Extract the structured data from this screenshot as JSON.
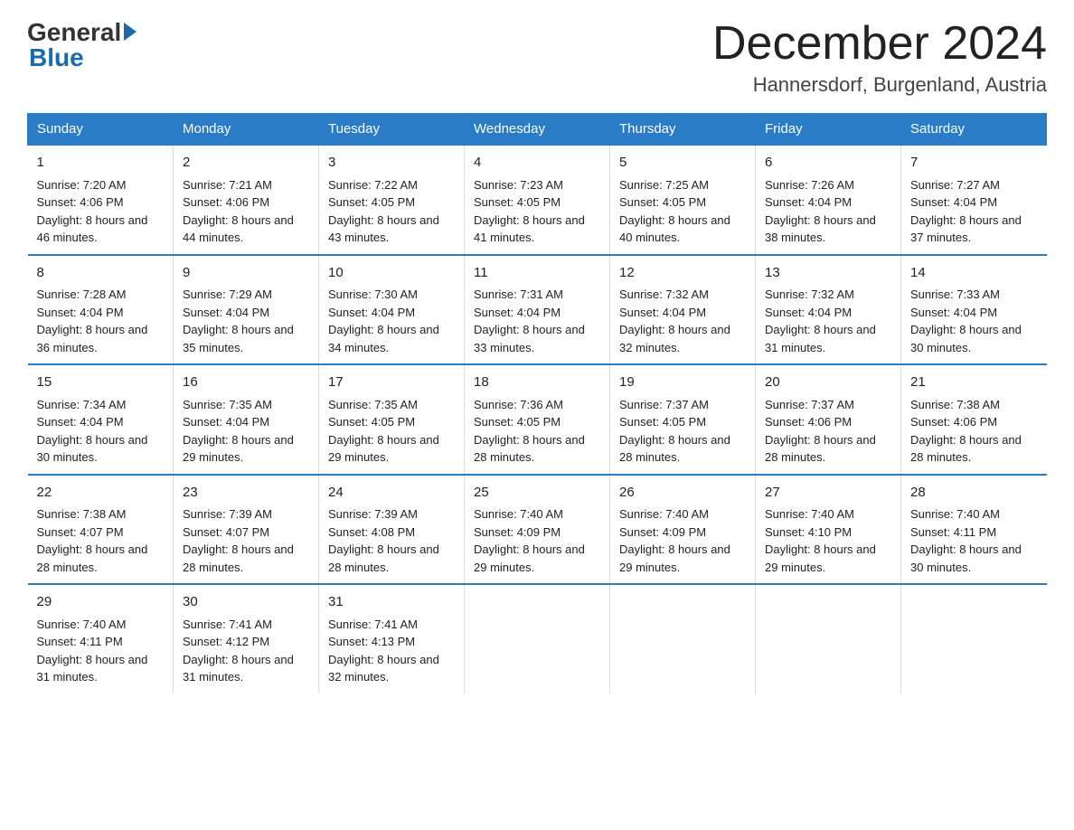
{
  "header": {
    "logo_general": "General",
    "logo_blue": "Blue",
    "month_title": "December 2024",
    "location": "Hannersdorf, Burgenland, Austria"
  },
  "days_of_week": [
    "Sunday",
    "Monday",
    "Tuesday",
    "Wednesday",
    "Thursday",
    "Friday",
    "Saturday"
  ],
  "weeks": [
    [
      {
        "day": "1",
        "sunrise": "7:20 AM",
        "sunset": "4:06 PM",
        "daylight": "8 hours and 46 minutes."
      },
      {
        "day": "2",
        "sunrise": "7:21 AM",
        "sunset": "4:06 PM",
        "daylight": "8 hours and 44 minutes."
      },
      {
        "day": "3",
        "sunrise": "7:22 AM",
        "sunset": "4:05 PM",
        "daylight": "8 hours and 43 minutes."
      },
      {
        "day": "4",
        "sunrise": "7:23 AM",
        "sunset": "4:05 PM",
        "daylight": "8 hours and 41 minutes."
      },
      {
        "day": "5",
        "sunrise": "7:25 AM",
        "sunset": "4:05 PM",
        "daylight": "8 hours and 40 minutes."
      },
      {
        "day": "6",
        "sunrise": "7:26 AM",
        "sunset": "4:04 PM",
        "daylight": "8 hours and 38 minutes."
      },
      {
        "day": "7",
        "sunrise": "7:27 AM",
        "sunset": "4:04 PM",
        "daylight": "8 hours and 37 minutes."
      }
    ],
    [
      {
        "day": "8",
        "sunrise": "7:28 AM",
        "sunset": "4:04 PM",
        "daylight": "8 hours and 36 minutes."
      },
      {
        "day": "9",
        "sunrise": "7:29 AM",
        "sunset": "4:04 PM",
        "daylight": "8 hours and 35 minutes."
      },
      {
        "day": "10",
        "sunrise": "7:30 AM",
        "sunset": "4:04 PM",
        "daylight": "8 hours and 34 minutes."
      },
      {
        "day": "11",
        "sunrise": "7:31 AM",
        "sunset": "4:04 PM",
        "daylight": "8 hours and 33 minutes."
      },
      {
        "day": "12",
        "sunrise": "7:32 AM",
        "sunset": "4:04 PM",
        "daylight": "8 hours and 32 minutes."
      },
      {
        "day": "13",
        "sunrise": "7:32 AM",
        "sunset": "4:04 PM",
        "daylight": "8 hours and 31 minutes."
      },
      {
        "day": "14",
        "sunrise": "7:33 AM",
        "sunset": "4:04 PM",
        "daylight": "8 hours and 30 minutes."
      }
    ],
    [
      {
        "day": "15",
        "sunrise": "7:34 AM",
        "sunset": "4:04 PM",
        "daylight": "8 hours and 30 minutes."
      },
      {
        "day": "16",
        "sunrise": "7:35 AM",
        "sunset": "4:04 PM",
        "daylight": "8 hours and 29 minutes."
      },
      {
        "day": "17",
        "sunrise": "7:35 AM",
        "sunset": "4:05 PM",
        "daylight": "8 hours and 29 minutes."
      },
      {
        "day": "18",
        "sunrise": "7:36 AM",
        "sunset": "4:05 PM",
        "daylight": "8 hours and 28 minutes."
      },
      {
        "day": "19",
        "sunrise": "7:37 AM",
        "sunset": "4:05 PM",
        "daylight": "8 hours and 28 minutes."
      },
      {
        "day": "20",
        "sunrise": "7:37 AM",
        "sunset": "4:06 PM",
        "daylight": "8 hours and 28 minutes."
      },
      {
        "day": "21",
        "sunrise": "7:38 AM",
        "sunset": "4:06 PM",
        "daylight": "8 hours and 28 minutes."
      }
    ],
    [
      {
        "day": "22",
        "sunrise": "7:38 AM",
        "sunset": "4:07 PM",
        "daylight": "8 hours and 28 minutes."
      },
      {
        "day": "23",
        "sunrise": "7:39 AM",
        "sunset": "4:07 PM",
        "daylight": "8 hours and 28 minutes."
      },
      {
        "day": "24",
        "sunrise": "7:39 AM",
        "sunset": "4:08 PM",
        "daylight": "8 hours and 28 minutes."
      },
      {
        "day": "25",
        "sunrise": "7:40 AM",
        "sunset": "4:09 PM",
        "daylight": "8 hours and 29 minutes."
      },
      {
        "day": "26",
        "sunrise": "7:40 AM",
        "sunset": "4:09 PM",
        "daylight": "8 hours and 29 minutes."
      },
      {
        "day": "27",
        "sunrise": "7:40 AM",
        "sunset": "4:10 PM",
        "daylight": "8 hours and 29 minutes."
      },
      {
        "day": "28",
        "sunrise": "7:40 AM",
        "sunset": "4:11 PM",
        "daylight": "8 hours and 30 minutes."
      }
    ],
    [
      {
        "day": "29",
        "sunrise": "7:40 AM",
        "sunset": "4:11 PM",
        "daylight": "8 hours and 31 minutes."
      },
      {
        "day": "30",
        "sunrise": "7:41 AM",
        "sunset": "4:12 PM",
        "daylight": "8 hours and 31 minutes."
      },
      {
        "day": "31",
        "sunrise": "7:41 AM",
        "sunset": "4:13 PM",
        "daylight": "8 hours and 32 minutes."
      },
      null,
      null,
      null,
      null
    ]
  ],
  "labels": {
    "sunrise_prefix": "Sunrise: ",
    "sunset_prefix": "Sunset: ",
    "daylight_prefix": "Daylight: "
  }
}
